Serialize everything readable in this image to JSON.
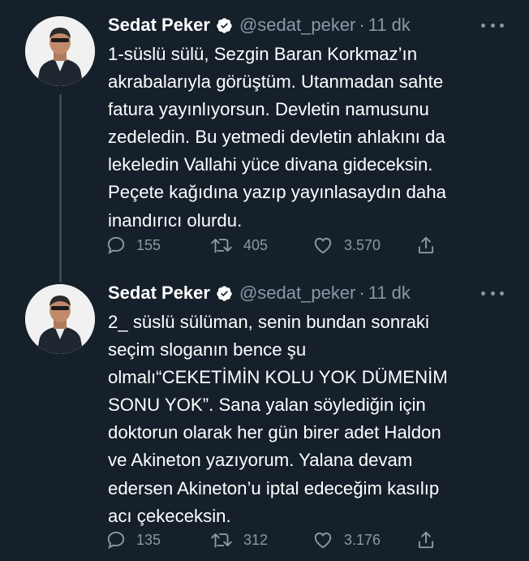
{
  "tweets": [
    {
      "name": "Sedat Peker",
      "handle": "@sedat_peker",
      "separator": "·",
      "time": "11 dk",
      "text": "1-süslü sülü, Sezgin Baran Korkmaz’ın\nakrabalarıyla görüştüm. Utanmadan sahte\nfatura yayınlıyorsun. Devletin namusunu\nzedeledin. Bu yetmedi devletin ahlakını da\nlekeledin Vallahi yüce divana gideceksin.\nPeçete kağıdına yazıp yayınlasaydın daha\ninandırıcı olurdu.",
      "replies": "155",
      "retweets": "405",
      "likes": "3.570"
    },
    {
      "name": "Sedat Peker",
      "handle": "@sedat_peker",
      "separator": "·",
      "time": "11 dk",
      "text": "2_ süslü sülüman, senin bundan sonraki\nseçim sloganın bence şu\nolmalı“CEKETİMİN KOLU YOK DÜMENİM\nSONU YOK”. Sana yalan söylediğin için\ndoktorun olarak her gün birer adet Haldon\nve Akineton yazıyorum. Yalana devam\nedersen Akineton’u iptal edeceğim kasılıp\nacı çekeceksin.",
      "replies": "135",
      "retweets": "312",
      "likes": "3.176"
    }
  ],
  "icons": {
    "verified": "verified-badge-icon",
    "more": "more-horizontal-icon",
    "reply": "reply-icon",
    "retweet": "retweet-icon",
    "like": "like-heart-icon",
    "share": "share-icon"
  },
  "colors": {
    "background": "#15202b",
    "text": "#ffffff",
    "secondary": "#8899a6",
    "thread_line": "#3a4650"
  }
}
